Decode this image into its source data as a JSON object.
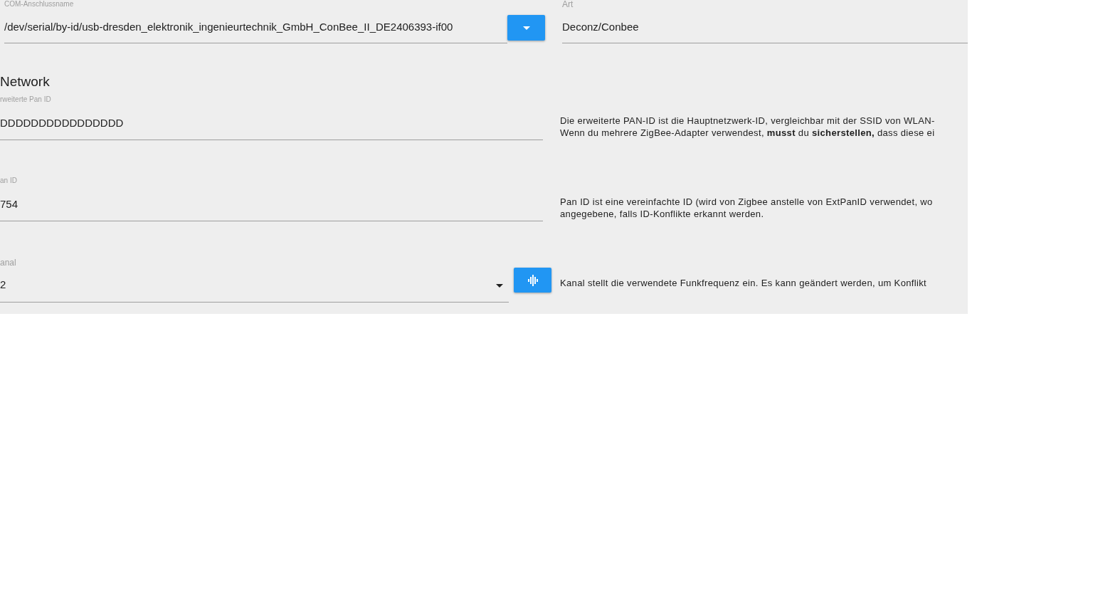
{
  "connection": {
    "port_field": {
      "label": "COM-Anschlussname",
      "value": "/dev/serial/by-id/usb-dresden_elektronik_ingenieurtechnik_GmbH_ConBee_II_DE2406393-if00"
    },
    "type_field": {
      "label": "Art",
      "value": "Deconz/Conbee"
    }
  },
  "network": {
    "heading": "Network",
    "fields": [
      {
        "kind": "text",
        "label": "rweiterte Pan ID",
        "value": "DDDDDDDDDDDDDDDD",
        "description": [
          "Die erweiterte PAN-ID ist die Hauptnetzwerk-ID, vergleichbar mit der SSID von WLAN-",
          "Wenn du mehrere ZigBee-Adapter verwendest, **musst** du **sicherstellen,** dass diese ei"
        ]
      },
      {
        "kind": "text",
        "label": "an ID",
        "value": "754",
        "description": [
          "Pan ID ist eine vereinfachte ID (wird von Zigbee anstelle von ExtPanID verwendet, wo",
          "angegebene, falls ID-Konflikte erkannt werden."
        ]
      },
      {
        "kind": "select",
        "label": "anal",
        "value": "2",
        "description": [
          "Kanal stellt die verwendete Funkfrequenz ein. Es kann geändert werden, um Konflikt"
        ]
      }
    ]
  }
}
